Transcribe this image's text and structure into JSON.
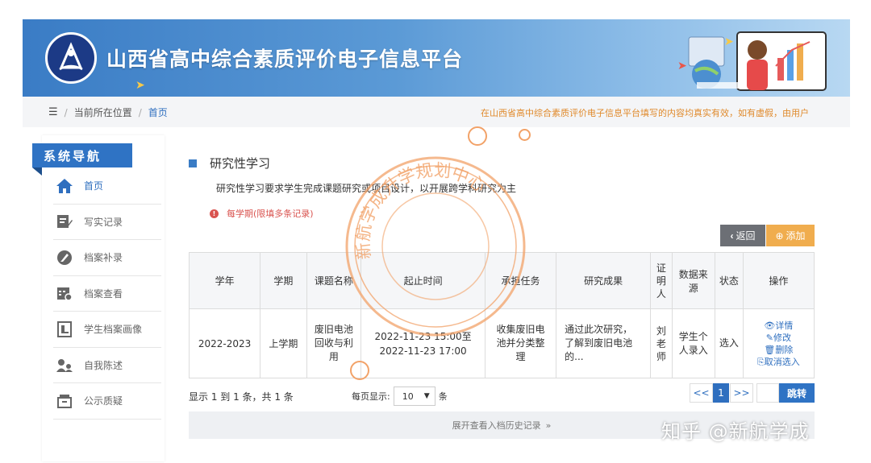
{
  "header": {
    "title": "山西省高中综合素质评价电子信息平台"
  },
  "breadcrumb": {
    "location_label": "当前所在位置",
    "current": "首页",
    "notice": "在山西省高中综合素质评价电子信息平台填写的内容均真实有效，如有虚假，由用户"
  },
  "sidebar": {
    "heading": "系统导航",
    "items": [
      {
        "label": "首页",
        "icon": "home-icon"
      },
      {
        "label": "写实记录",
        "icon": "edit-note-icon"
      },
      {
        "label": "档案补录",
        "icon": "pencil-circle-icon"
      },
      {
        "label": "档案查看",
        "icon": "calendar-view-icon"
      },
      {
        "label": "学生档案画像",
        "icon": "profile-doc-icon"
      },
      {
        "label": "自我陈述",
        "icon": "user-speak-icon"
      },
      {
        "label": "公示质疑",
        "icon": "notice-box-icon"
      }
    ]
  },
  "main": {
    "title": "研究性学习",
    "description": "研究性学习要求学生完成课题研究或项目设计，以开展跨学科研究为主",
    "warning": "每学期(限填多条记录)",
    "back_label": "返回",
    "add_label": "添加",
    "table": {
      "headers": [
        "学年",
        "学期",
        "课题名称",
        "起止时间",
        "承担任务",
        "研究成果",
        "证明人",
        "数据来源",
        "状态",
        "操作"
      ],
      "rows": [
        {
          "year": "2022-2023",
          "term": "上学期",
          "topic": "废旧电池回收与利用",
          "time": "2022-11-23 15:00至2022-11-23 17:00",
          "task": "收集废旧电池并分类整理",
          "result": "通过此次研究，了解到废旧电池的...",
          "witness": "刘老师",
          "source": "学生个人录入",
          "status": "选入",
          "ops": [
            "详情",
            "修改",
            "删除",
            "取消选入"
          ]
        }
      ]
    },
    "pager": {
      "info": "显示 1 到 1 条，共 1 条",
      "per_page_label": "每页显示:",
      "per_page_value": "10",
      "per_page_unit": "条",
      "prev": "<<",
      "current": "1",
      "next": ">>",
      "go": "跳转"
    },
    "expand_label": "展开查看入档历史记录"
  },
  "overlay": {
    "stamp_text": "新航学成升学规划中心",
    "watermark": "知乎 @新航学成"
  },
  "colors": {
    "brand_blue": "#2f73c4",
    "accent_orange": "#f0ad4e",
    "warning_red": "#d9534f"
  }
}
